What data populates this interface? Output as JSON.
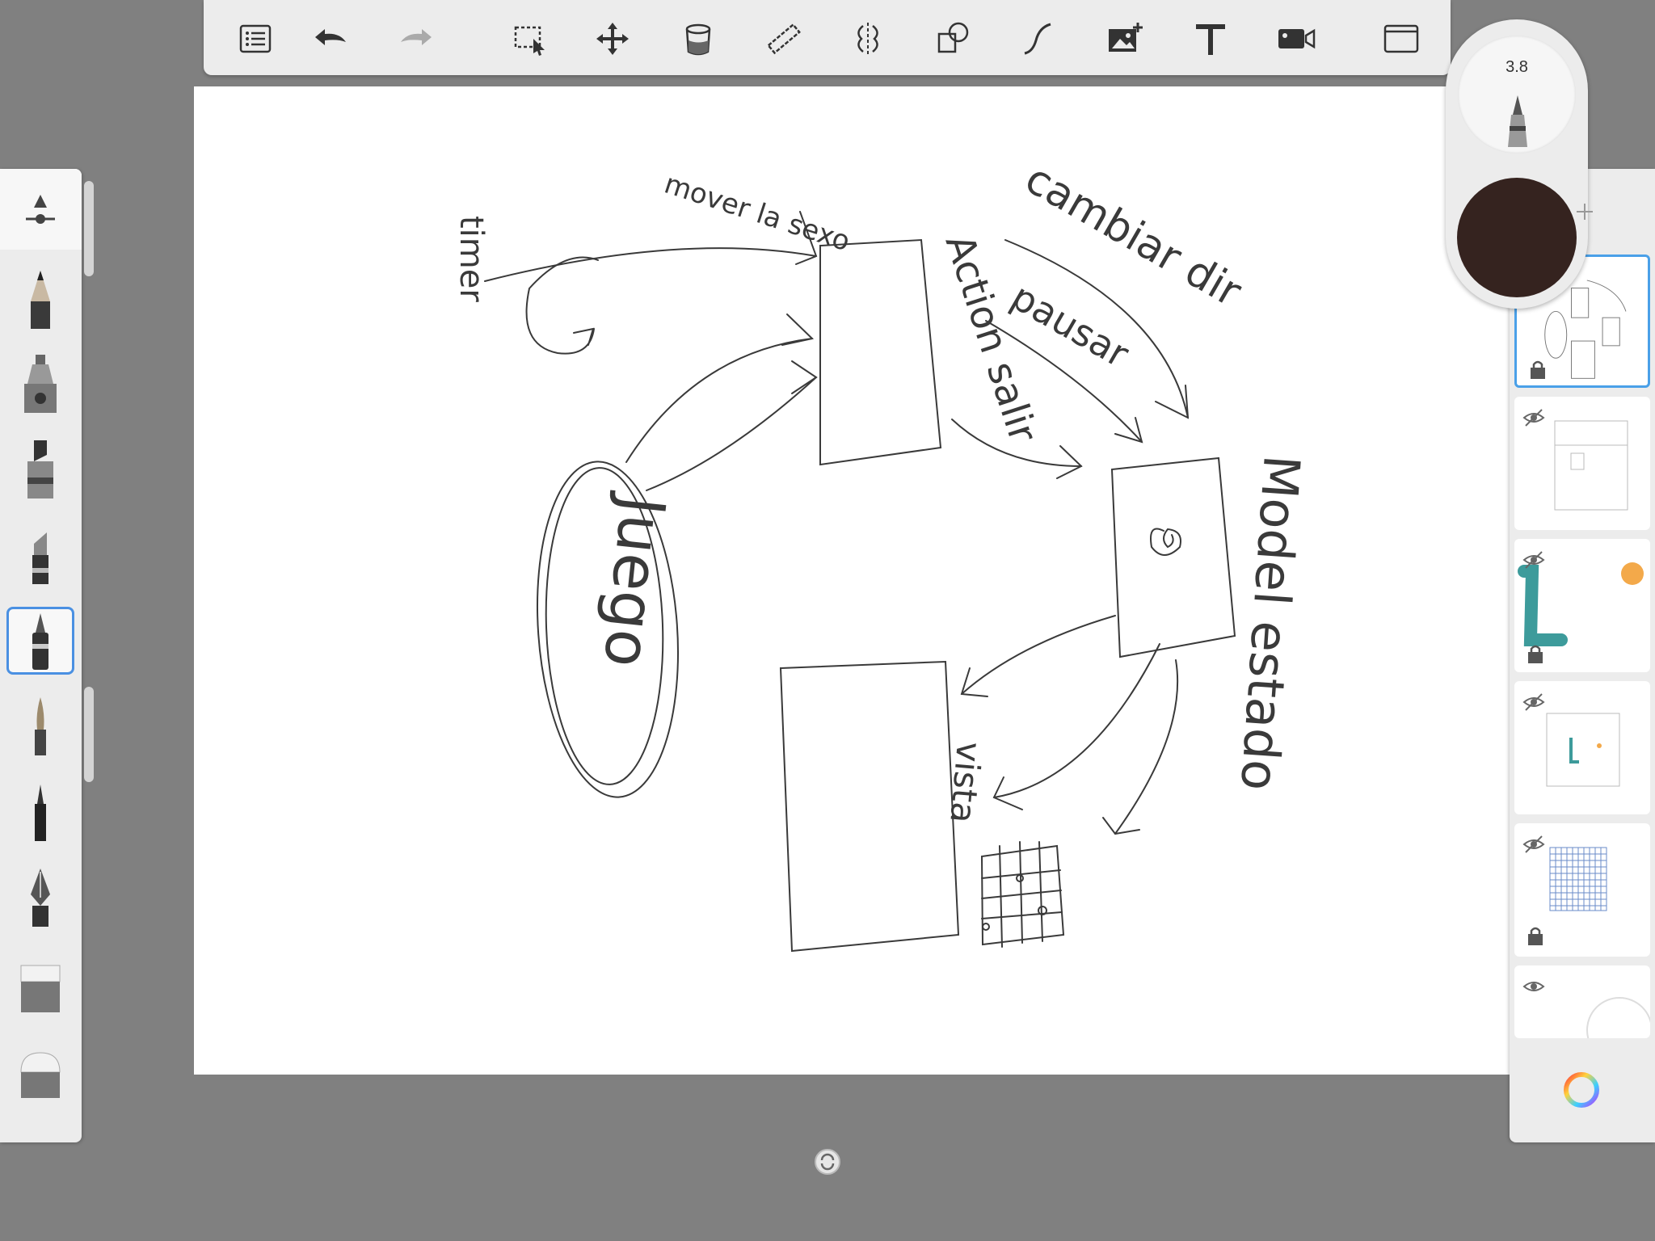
{
  "app": {
    "background": "#808080"
  },
  "toolbar": {
    "buttons": [
      {
        "name": "layers-list",
        "icon": "list-icon"
      },
      {
        "name": "undo",
        "icon": "undo-arrow-icon"
      },
      {
        "name": "redo",
        "icon": "redo-arrow-icon",
        "enabled": false
      },
      {
        "name": "selection",
        "icon": "selection-icon"
      },
      {
        "name": "transform",
        "icon": "move-icon"
      },
      {
        "name": "fill",
        "icon": "paint-bucket-icon"
      },
      {
        "name": "ruler",
        "icon": "ruler-icon"
      },
      {
        "name": "symmetry",
        "icon": "symmetry-icon"
      },
      {
        "name": "shapes",
        "icon": "shapes-icon"
      },
      {
        "name": "curve",
        "icon": "curve-icon"
      },
      {
        "name": "add-image",
        "icon": "add-image-icon"
      },
      {
        "name": "text",
        "icon": "text-icon",
        "glyph": "T"
      },
      {
        "name": "record-video",
        "icon": "video-camera-icon"
      },
      {
        "name": "fullscreen",
        "icon": "fullscreen-icon"
      }
    ]
  },
  "brush_panel": {
    "brushes": [
      {
        "name": "opacity-slider",
        "icon": "opacity-slider-icon"
      },
      {
        "name": "pencil",
        "icon": "pencil-icon"
      },
      {
        "name": "airbrush",
        "icon": "airbrush-icon"
      },
      {
        "name": "marker",
        "icon": "marker-icon"
      },
      {
        "name": "chisel-marker",
        "icon": "chisel-marker-icon"
      },
      {
        "name": "ballpoint-pen",
        "icon": "ballpoint-pen-icon",
        "selected": true
      },
      {
        "name": "paintbrush",
        "icon": "paintbrush-icon"
      },
      {
        "name": "fine-liner",
        "icon": "fine-liner-icon"
      },
      {
        "name": "fountain-pen",
        "icon": "fountain-pen-icon"
      },
      {
        "name": "eraser-hard",
        "icon": "eraser-icon"
      },
      {
        "name": "eraser-soft",
        "icon": "soft-eraser-icon"
      }
    ]
  },
  "color_puck": {
    "brush_size": "3.8",
    "color": "#35231f"
  },
  "layers": {
    "items": [
      {
        "name": "layer-1",
        "visible": true,
        "locked": false,
        "selected": true
      },
      {
        "name": "layer-2",
        "visible": false,
        "locked": false
      },
      {
        "name": "layer-3",
        "visible": false,
        "locked": true
      },
      {
        "name": "layer-4",
        "visible": false,
        "locked": false
      },
      {
        "name": "layer-5",
        "visible": false,
        "locked": true
      },
      {
        "name": "layer-6",
        "visible": true,
        "locked": false
      }
    ],
    "accent": "#4aa0e8"
  },
  "canvas": {
    "sketch_labels": {
      "timer": "timer",
      "mover_la_sexo": "mover la sexo",
      "cambiar_dir": "cambiar dir",
      "pausar": "pausar",
      "action_salir": "Action salir",
      "model_estado": "Model estado",
      "vista": "vista",
      "juego": "Juego"
    },
    "ink_color": "#3a3a3a"
  }
}
